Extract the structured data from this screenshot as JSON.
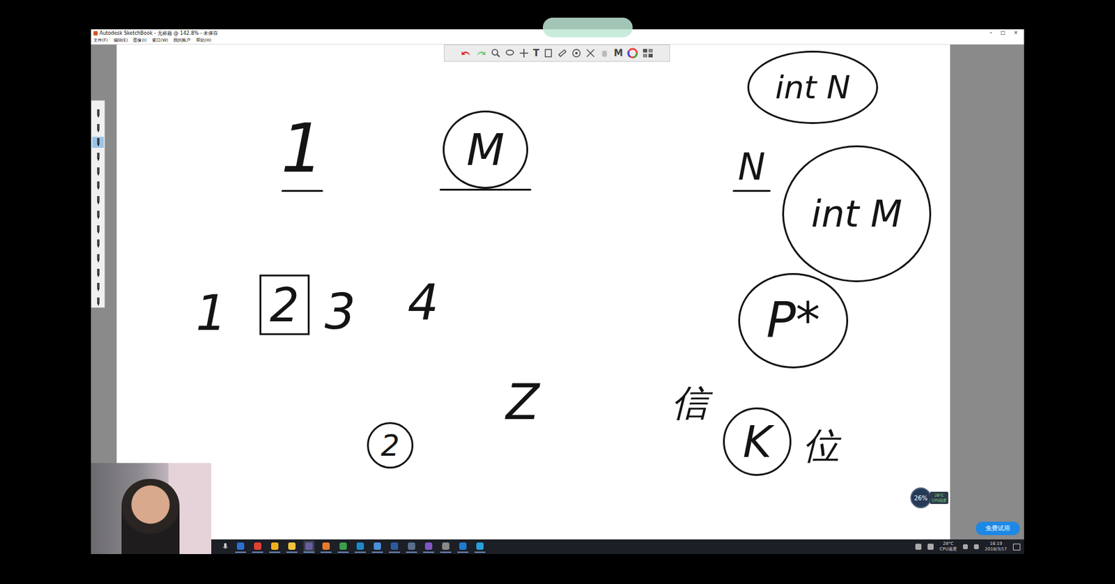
{
  "window": {
    "title": "Autodesk SketchBook - 无标题 @ 142.8% - 未保存",
    "controls": [
      "–",
      "□",
      "×"
    ]
  },
  "menu": [
    "文件(F)",
    "编辑(E)",
    "图像(I)",
    "窗口(W)",
    "我的账户",
    "帮助(H)"
  ],
  "toolbar": {
    "type_tool": "T",
    "symmetry_tool": "M"
  },
  "canvas_items": [
    {
      "text": "1",
      "circled": false,
      "boxed": false,
      "underlined": true
    },
    {
      "text": "M",
      "circled": true,
      "boxed": false,
      "underlined": true
    },
    {
      "text": "int N",
      "circled": true,
      "boxed": false,
      "underlined": false
    },
    {
      "text": "N",
      "circled": false,
      "boxed": false,
      "underlined": true
    },
    {
      "text": "int M",
      "circled": true,
      "boxed": false,
      "underlined": false
    },
    {
      "text": "P*",
      "circled": true,
      "boxed": false,
      "underlined": false
    },
    {
      "text": "1",
      "circled": false,
      "boxed": false,
      "underlined": false
    },
    {
      "text": "2",
      "circled": false,
      "boxed": true,
      "underlined": false
    },
    {
      "text": "3",
      "circled": false,
      "boxed": false,
      "underlined": false
    },
    {
      "text": "4",
      "circled": false,
      "boxed": false,
      "underlined": false
    },
    {
      "text": "2",
      "circled": true,
      "boxed": false,
      "underlined": false
    },
    {
      "text": "Z",
      "circled": false,
      "boxed": false,
      "underlined": false
    },
    {
      "text": "信",
      "circled": false,
      "boxed": false,
      "underlined": false
    },
    {
      "text": "K",
      "circled": true,
      "boxed": false,
      "underlined": false
    },
    {
      "text": "位",
      "circled": false,
      "boxed": false,
      "underlined": false
    }
  ],
  "perf_badge": {
    "percent": "26%",
    "temp": "28°C",
    "label": "CPU温度"
  },
  "trial_button": "免费试用",
  "taskbar": {
    "temp": "28°C",
    "temp_label": "CPU温度",
    "time": "16:19",
    "date": "2018/3/17"
  }
}
